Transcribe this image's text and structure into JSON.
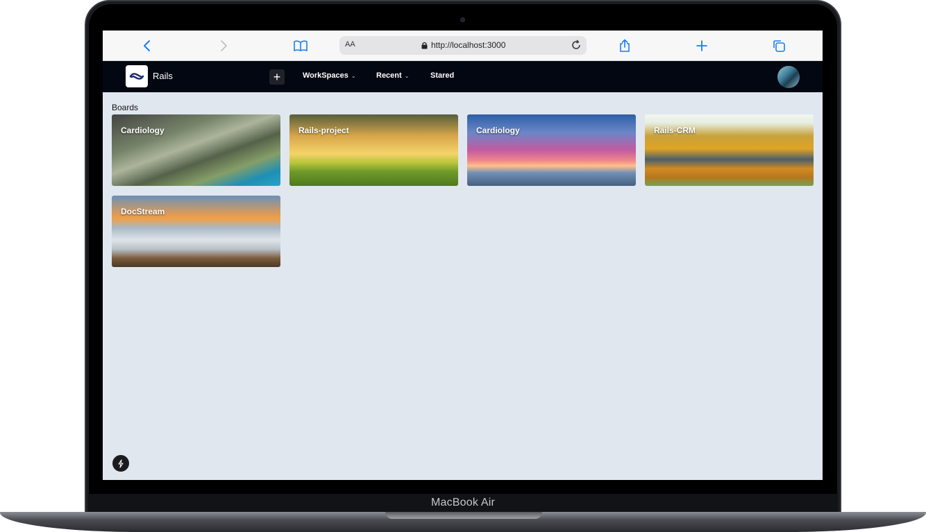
{
  "device": {
    "model_label": "MacBook Air"
  },
  "browser": {
    "text_size_label": "AA",
    "url": "http://localhost:3000",
    "icons": [
      "back-icon",
      "forward-icon",
      "bookmarks-icon",
      "lock-icon",
      "reload-icon",
      "share-icon",
      "new-tab-icon",
      "tabs-icon"
    ]
  },
  "navbar": {
    "brand": "Rails",
    "add_label": "+",
    "items": [
      {
        "label": "WorkSpaces",
        "has_dropdown": true
      },
      {
        "label": "Recent",
        "has_dropdown": true
      },
      {
        "label": "Stared",
        "has_dropdown": false
      }
    ]
  },
  "main": {
    "section_title": "Boards",
    "boards": [
      {
        "title": "Cardiology"
      },
      {
        "title": "Rails-project"
      },
      {
        "title": "Cardiology"
      },
      {
        "title": "Rails-CRM"
      },
      {
        "title": "DocStream"
      }
    ]
  },
  "colors": {
    "navbar_bg": "#030711",
    "content_bg": "#e1e7ef",
    "safari_accent": "#1a7cf2"
  }
}
